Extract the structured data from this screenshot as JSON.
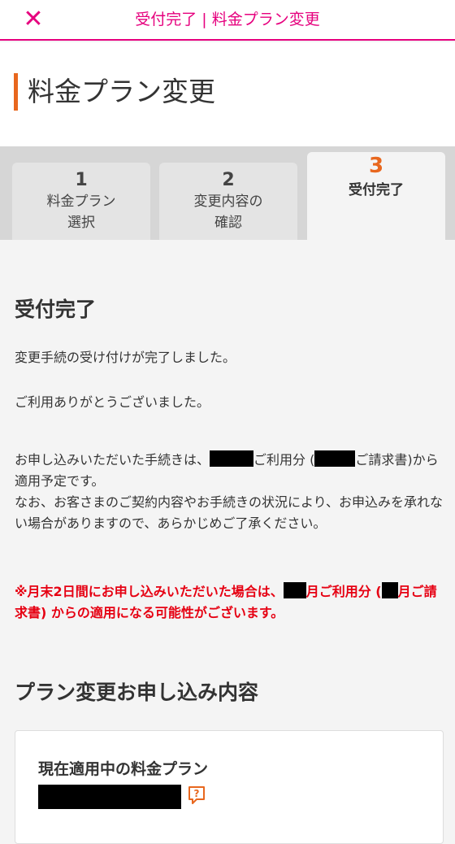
{
  "topbar": {
    "close_icon": "close-icon",
    "title": "受付完了 | 料金プラン変更"
  },
  "page": {
    "title": "料金プラン変更"
  },
  "steps": [
    {
      "number": "1",
      "label": "料金プラン\n選択",
      "state": "done"
    },
    {
      "number": "2",
      "label": "変更内容の\n確認",
      "state": "done"
    },
    {
      "number": "3",
      "label": "受付完了",
      "state": "current"
    }
  ],
  "receipt": {
    "heading": "受付完了",
    "line1": "変更手続の受け付けが完了しました。",
    "line2": "ご利用ありがとうございました。",
    "notice_a": "お申し込みいただいた手続きは、",
    "notice_b": "ご利用分 (",
    "notice_c": "ご請求書)から適用予定です。",
    "notice_d": "なお、お客さまのご契約内容やお手続きの状況により、お申込みを承れない場合がありますので、あらかじめご了承ください。",
    "warning_a": "※月末2日間にお申し込みいただいた場合は、",
    "warning_b": "月ご利用分 (",
    "warning_c": "月ご請求書) からの適用になる可能性がございます。"
  },
  "summary": {
    "heading": "プラン変更お申し込み内容",
    "current_plan_label": "現在適用中の料金プラン",
    "help_icon": "help-question-icon"
  },
  "colors": {
    "brand": "#e6007e",
    "accent": "#e8671e",
    "warning": "#e60012"
  }
}
